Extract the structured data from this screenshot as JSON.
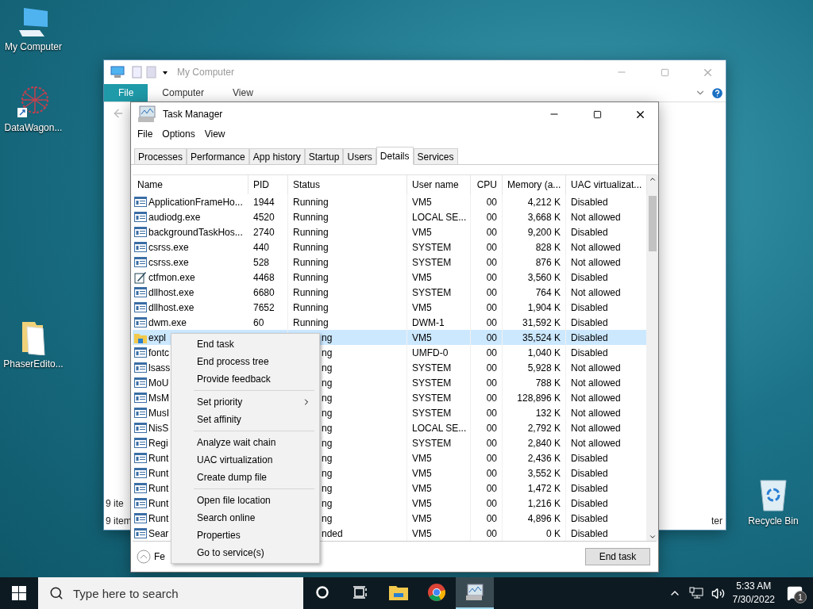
{
  "desktop_icons": [
    {
      "label": "My Computer",
      "kind": "computer"
    },
    {
      "label": "DataWagon...",
      "kind": "shortcut"
    },
    {
      "label": "PhaserEdito...",
      "kind": "folder"
    },
    {
      "label": "Recycle Bin",
      "kind": "bin"
    }
  ],
  "explorer": {
    "title": "My Computer",
    "ribbon_tabs": [
      {
        "label": "File",
        "selected": true
      },
      {
        "label": "Computer",
        "selected": false
      },
      {
        "label": "View",
        "selected": false
      }
    ],
    "nav_count": "9 ite",
    "status_left": "9 item",
    "status_right": "ter"
  },
  "task_manager": {
    "title": "Task Manager",
    "menu": [
      "File",
      "Options",
      "View"
    ],
    "tabs": [
      {
        "label": "Processes",
        "selected": false
      },
      {
        "label": "Performance",
        "selected": false
      },
      {
        "label": "App history",
        "selected": false
      },
      {
        "label": "Startup",
        "selected": false
      },
      {
        "label": "Users",
        "selected": false
      },
      {
        "label": "Details",
        "selected": true
      },
      {
        "label": "Services",
        "selected": false
      }
    ],
    "columns": [
      "Name",
      "PID",
      "Status",
      "User name",
      "CPU",
      "Memory (a...",
      "UAC virtualizat..."
    ],
    "rows": [
      {
        "kind": "app",
        "name": "ApplicationFrameHo...",
        "pid": "1944",
        "status": "Running",
        "user": "VM5",
        "cpu": "00",
        "memory": "4,212 K",
        "uac": "Disabled",
        "selected": false
      },
      {
        "kind": "app",
        "name": "audiodg.exe",
        "pid": "4520",
        "status": "Running",
        "user": "LOCAL SE...",
        "cpu": "00",
        "memory": "3,668 K",
        "uac": "Not allowed",
        "selected": false
      },
      {
        "kind": "app",
        "name": "backgroundTaskHos...",
        "pid": "2740",
        "status": "Running",
        "user": "VM5",
        "cpu": "00",
        "memory": "9,200 K",
        "uac": "Disabled",
        "selected": false
      },
      {
        "kind": "app",
        "name": "csrss.exe",
        "pid": "440",
        "status": "Running",
        "user": "SYSTEM",
        "cpu": "00",
        "memory": "828 K",
        "uac": "Not allowed",
        "selected": false
      },
      {
        "kind": "app",
        "name": "csrss.exe",
        "pid": "528",
        "status": "Running",
        "user": "SYSTEM",
        "cpu": "00",
        "memory": "876 K",
        "uac": "Not allowed",
        "selected": false
      },
      {
        "kind": "pen",
        "name": "ctfmon.exe",
        "pid": "4468",
        "status": "Running",
        "user": "VM5",
        "cpu": "00",
        "memory": "3,560 K",
        "uac": "Disabled",
        "selected": false
      },
      {
        "kind": "app",
        "name": "dllhost.exe",
        "pid": "6680",
        "status": "Running",
        "user": "SYSTEM",
        "cpu": "00",
        "memory": "764 K",
        "uac": "Not allowed",
        "selected": false
      },
      {
        "kind": "app",
        "name": "dllhost.exe",
        "pid": "7652",
        "status": "Running",
        "user": "VM5",
        "cpu": "00",
        "memory": "1,904 K",
        "uac": "Disabled",
        "selected": false
      },
      {
        "kind": "app",
        "name": "dwm.exe",
        "pid": "60",
        "status": "Running",
        "user": "DWM-1",
        "cpu": "00",
        "memory": "31,592 K",
        "uac": "Disabled",
        "selected": false
      },
      {
        "kind": "folder",
        "name": "expl",
        "status": "ng",
        "user": "VM5",
        "cpu": "00",
        "memory": "35,524 K",
        "uac": "Disabled",
        "selected": true
      },
      {
        "kind": "app",
        "name": "fontc",
        "status": "ng",
        "user": "UMFD-0",
        "cpu": "00",
        "memory": "1,040 K",
        "uac": "Disabled",
        "selected": false
      },
      {
        "kind": "app",
        "name": "lsass",
        "status": "ng",
        "user": "SYSTEM",
        "cpu": "00",
        "memory": "5,928 K",
        "uac": "Not allowed",
        "selected": false
      },
      {
        "kind": "app",
        "name": "MoU",
        "status": "ng",
        "user": "SYSTEM",
        "cpu": "00",
        "memory": "788 K",
        "uac": "Not allowed",
        "selected": false
      },
      {
        "kind": "app",
        "name": "MsM",
        "status": "ng",
        "user": "SYSTEM",
        "cpu": "00",
        "memory": "128,896 K",
        "uac": "Not allowed",
        "selected": false
      },
      {
        "kind": "app",
        "name": "MusI",
        "status": "ng",
        "user": "SYSTEM",
        "cpu": "00",
        "memory": "132 K",
        "uac": "Not allowed",
        "selected": false
      },
      {
        "kind": "app",
        "name": "NisS",
        "status": "ng",
        "user": "LOCAL SE...",
        "cpu": "00",
        "memory": "2,792 K",
        "uac": "Not allowed",
        "selected": false
      },
      {
        "kind": "app",
        "name": "Regi",
        "status": "ng",
        "user": "SYSTEM",
        "cpu": "00",
        "memory": "2,840 K",
        "uac": "Not allowed",
        "selected": false
      },
      {
        "kind": "app",
        "name": "Runt",
        "status": "ng",
        "user": "VM5",
        "cpu": "00",
        "memory": "2,436 K",
        "uac": "Disabled",
        "selected": false
      },
      {
        "kind": "app",
        "name": "Runt",
        "status": "ng",
        "user": "VM5",
        "cpu": "00",
        "memory": "3,552 K",
        "uac": "Disabled",
        "selected": false
      },
      {
        "kind": "app",
        "name": "Runt",
        "status": "ng",
        "user": "VM5",
        "cpu": "00",
        "memory": "1,472 K",
        "uac": "Disabled",
        "selected": false
      },
      {
        "kind": "app",
        "name": "Runt",
        "status": "ng",
        "user": "VM5",
        "cpu": "00",
        "memory": "1,216 K",
        "uac": "Disabled",
        "selected": false
      },
      {
        "kind": "app",
        "name": "Runt",
        "status": "ng",
        "user": "VM5",
        "cpu": "00",
        "memory": "4,896 K",
        "uac": "Disabled",
        "selected": false
      },
      {
        "kind": "app",
        "name": "Sear",
        "status": "nded",
        "user": "VM5",
        "cpu": "00",
        "memory": "0 K",
        "uac": "Disabled",
        "selected": false
      }
    ],
    "fewer_details": "Fe",
    "end_task": "End task"
  },
  "context_menu": [
    [
      {
        "label": "End task",
        "submenu": false
      },
      {
        "label": "End process tree",
        "submenu": false
      },
      {
        "label": "Provide feedback",
        "submenu": false
      }
    ],
    [
      {
        "label": "Set priority",
        "submenu": true
      },
      {
        "label": "Set affinity",
        "submenu": false
      }
    ],
    [
      {
        "label": "Analyze wait chain",
        "submenu": false
      },
      {
        "label": "UAC virtualization",
        "submenu": false
      },
      {
        "label": "Create dump file",
        "submenu": false
      }
    ],
    [
      {
        "label": "Open file location",
        "submenu": false
      },
      {
        "label": "Search online",
        "submenu": false
      },
      {
        "label": "Properties",
        "submenu": false
      },
      {
        "label": "Go to service(s)",
        "submenu": false
      }
    ]
  ],
  "taskbar": {
    "search_placeholder": "Type here to search",
    "apps": [
      {
        "kind": "explorer",
        "selected": false
      },
      {
        "kind": "chrome",
        "selected": false
      },
      {
        "kind": "taskmgr",
        "selected": true
      }
    ],
    "time": "5:33 AM",
    "date": "7/30/2022",
    "notification_count": "1"
  }
}
